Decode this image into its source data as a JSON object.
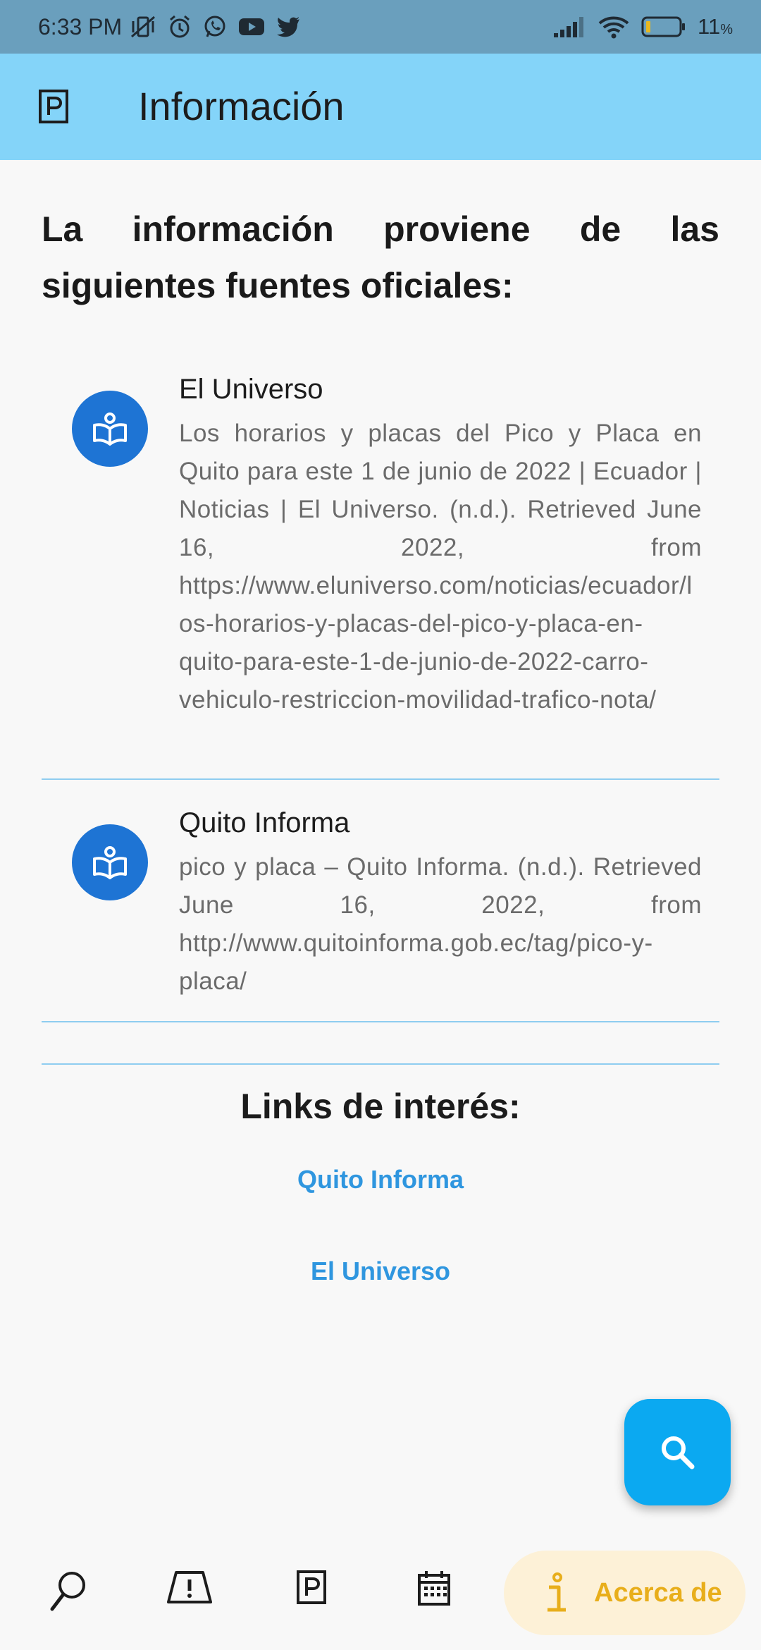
{
  "status_bar": {
    "time": "6:33 PM",
    "battery": "11",
    "battery_unit": "%"
  },
  "app_bar": {
    "logo_icon": "parking-p-icon",
    "title": "Información"
  },
  "heading": "La información proviene de las siguientes fuentes oficiales:",
  "sources": [
    {
      "icon": "open-book-icon",
      "name": "El Universo",
      "description": "Los horarios y placas del Pico y Placa en Quito para este 1 de junio de 2022 | Ecuador | Noticias | El Universo. (n.d.). Retrieved June 16, 2022, from https://www.eluniverso.com/noticias/ecuador/los-horarios-y-placas-del-pico-y-placa-en-quito-para-este-1-de-junio-de-2022-carro-vehiculo-restriccion-movilidad-trafico-nota/"
    },
    {
      "icon": "open-book-icon",
      "name": "Quito Informa",
      "description": "pico y placa – Quito Informa. (n.d.). Retrieved June 16, 2022, from http://www.quitoinforma.gob.ec/tag/pico-y-placa/"
    }
  ],
  "links": {
    "title": "Links de interés:",
    "items": [
      "Quito Informa",
      "El Universo"
    ]
  },
  "bottom_nav": {
    "items": [
      "search-icon",
      "road-warning-icon",
      "parking-p-icon",
      "calendar-icon"
    ],
    "active_label": "Acerca de",
    "active_icon": "info-icon"
  },
  "colors": {
    "app_bar": "#84d4f9",
    "status_bar": "#6a9fbd",
    "avatar": "#1e74d4",
    "link": "#2f96df",
    "fab": "#0ba9f1",
    "active_nav_bg": "#fdf1d7",
    "active_nav_fg": "#e8ae1b"
  }
}
